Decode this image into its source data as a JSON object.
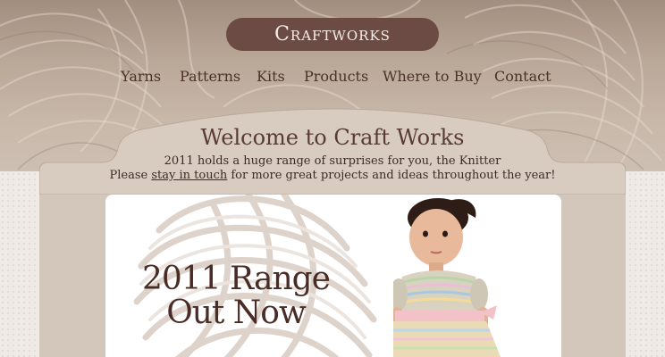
{
  "brand": {
    "logo_text": "Craftworks"
  },
  "nav": {
    "items": [
      {
        "label": "Yarns"
      },
      {
        "label": "Patterns"
      },
      {
        "label": "Kits"
      },
      {
        "label": "Products"
      },
      {
        "label": "Where to Buy"
      },
      {
        "label": "Contact"
      }
    ]
  },
  "welcome": {
    "title": "Welcome to Craft Works",
    "line1": "2011 holds a huge range of surprises for you, the Knitter",
    "line2_before": "Please ",
    "line2_link": "stay in touch",
    "line2_after": " for more great projects and ideas throughout the year!"
  },
  "hero": {
    "line1": "2011 Range",
    "line2": "Out Now"
  },
  "colors": {
    "logo_bg": "#6b4b44",
    "nav_text": "#4b312b",
    "title_text": "#5a3b34",
    "panel_bg": "#d3c6ba"
  }
}
